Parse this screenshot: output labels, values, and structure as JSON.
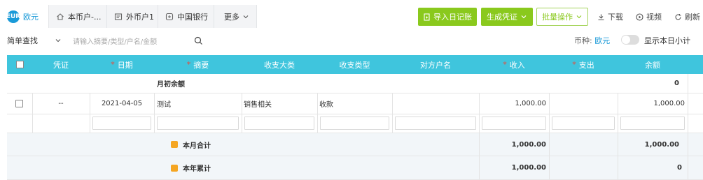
{
  "tabs": [
    {
      "label": "欧元",
      "icon": "currency-badge-icon",
      "badge": "EUR"
    },
    {
      "label": "本币户-...",
      "icon": "home-icon"
    },
    {
      "label": "外币户1",
      "icon": "card-icon"
    },
    {
      "label": "中国银行",
      "icon": "bank-icon"
    },
    {
      "label": "更多",
      "icon": "chevron-down-icon"
    }
  ],
  "toolbar": {
    "import_label": "导入日记账",
    "generate_label": "生成凭证",
    "batch_label": "批量操作",
    "download_label": "下载",
    "video_label": "视频",
    "refresh_label": "刷新"
  },
  "filter": {
    "mode_label": "简单查找",
    "search_placeholder": "请输入摘要/类型/户名/金额",
    "currency_label": "币种:",
    "currency_value": "欧元",
    "daily_subtotal_label": "显示本日小计",
    "daily_subtotal_on": false
  },
  "table": {
    "headers": {
      "voucher": "凭证",
      "date": "日期",
      "summary": "摘要",
      "category": "收支大类",
      "type": "收支类型",
      "counterparty": "对方户名",
      "income": "收入",
      "expense": "支出",
      "balance": "余额"
    },
    "opening_row": {
      "label": "月初余额",
      "balance": "0"
    },
    "rows": [
      {
        "voucher": "--",
        "date": "2021-04-05",
        "summary": "测试",
        "category": "销售相关",
        "type": "收款",
        "counterparty": "",
        "income": "1,000.00",
        "expense": "",
        "balance": "1,000.00"
      }
    ],
    "month_total": {
      "label": "本月合计",
      "income": "1,000.00",
      "expense": "",
      "balance": "1,000.00"
    },
    "year_total": {
      "label": "本年累计",
      "income": "1,000.00",
      "expense": "",
      "balance": "0"
    }
  },
  "colors": {
    "accent": "#1a9ad8",
    "header_bg": "#3fc5dd",
    "green": "#8ac91d",
    "required": "#e74c3c"
  }
}
